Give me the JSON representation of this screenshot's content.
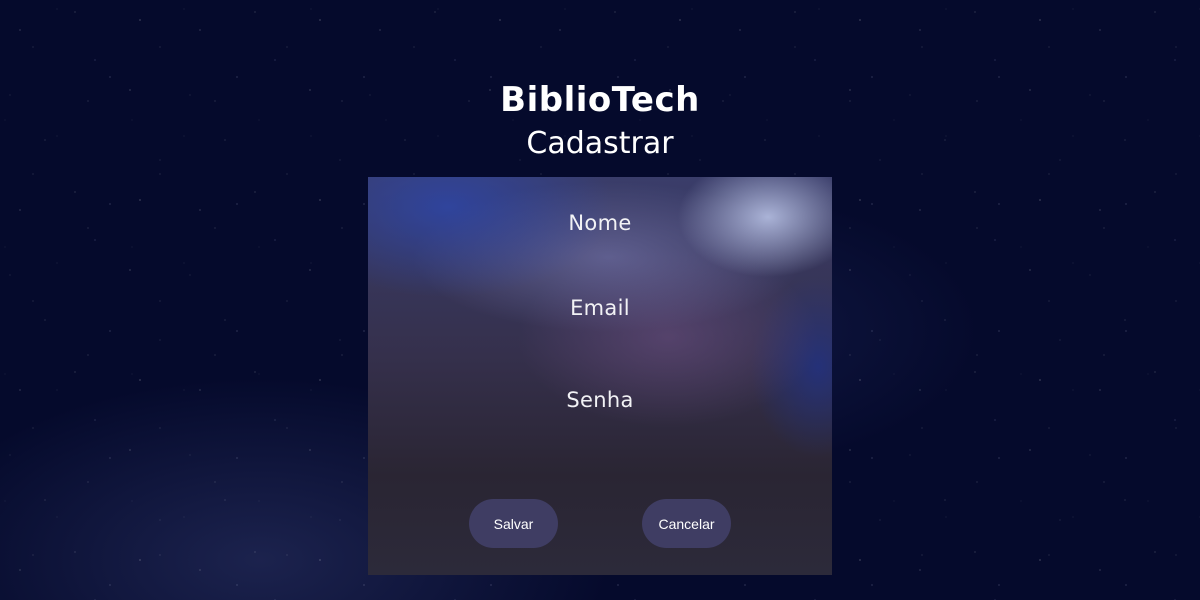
{
  "app": {
    "title": "BiblioTech",
    "subtitle": "Cadastrar"
  },
  "form": {
    "fields": [
      {
        "label": "Nome"
      },
      {
        "label": "Email"
      },
      {
        "label": "Senha"
      }
    ],
    "buttons": {
      "save_label": "Salvar",
      "cancel_label": "Cancelar"
    }
  },
  "colors": {
    "background": "#050a2c",
    "button": "#3f3d63",
    "text": "#ffffff"
  }
}
